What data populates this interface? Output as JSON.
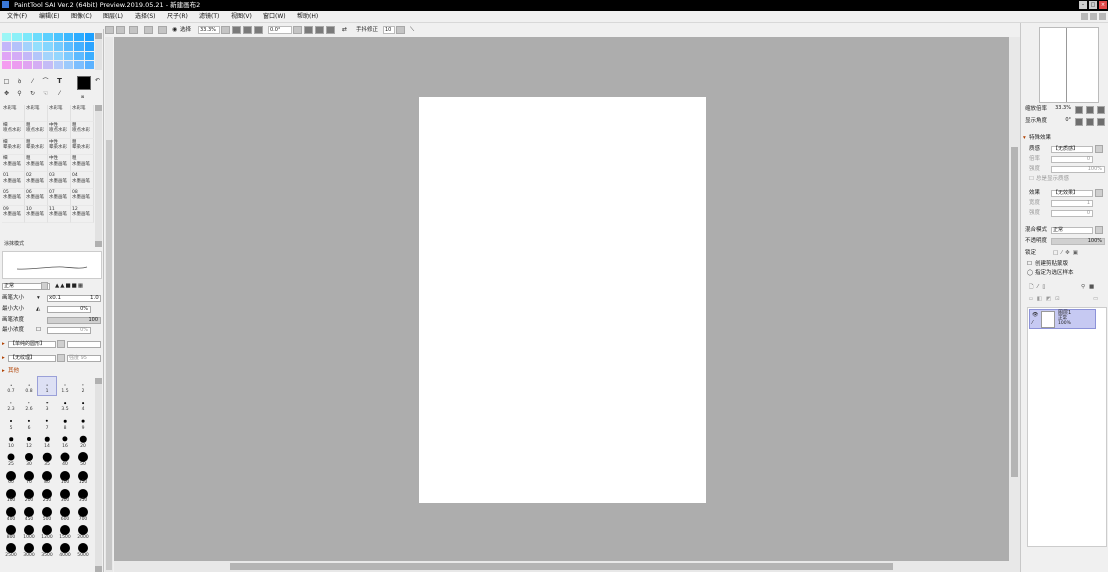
{
  "title_bar": {
    "title": "PaintTool SAI Ver.2 (64bit) Preview.2019.05.21 - 新建画布2"
  },
  "menu": [
    "文件(F)",
    "编辑(E)",
    "图像(C)",
    "图层(L)",
    "选择(S)",
    "尺子(R)",
    "滤镜(T)",
    "视图(V)",
    "窗口(W)",
    "帮助(H)"
  ],
  "toolbar": {
    "selection_label": "选择",
    "zoom": "33.3%",
    "rotation": "0.0°",
    "stabilizer_label": "手抖修正",
    "stabilizer_value": "10"
  },
  "palette_colors": [
    "#9cf6f6",
    "#8cf0f8",
    "#7ce8fa",
    "#6cdcfc",
    "#5cd0fe",
    "#4cc4ff",
    "#3cb8ff",
    "#2cacff",
    "#1ca0ff",
    "#c4b6fa",
    "#b4c2fa",
    "#a4d2fc",
    "#94dffd",
    "#84d6fe",
    "#74cafe",
    "#5cbcff",
    "#44b0ff",
    "#2ca4ff",
    "#e0a4f6",
    "#d4acf6",
    "#c4b8f8",
    "#b4c6fa",
    "#a4d4fc",
    "#94d6fe",
    "#7ccaff",
    "#5cbaff",
    "#3caeff",
    "#f49cf0",
    "#ec9cf0",
    "#e0a4f2",
    "#d4aef4",
    "#c4bcf6",
    "#b4cafa",
    "#9ccafc",
    "#7cbefe",
    "#5cb2ff"
  ],
  "brushes": [
    {
      "label": "",
      "name": "水彩笔"
    },
    {
      "label": "",
      "name": "水彩笔"
    },
    {
      "label": "",
      "name": "水彩笔"
    },
    {
      "label": "",
      "name": "水彩笔"
    },
    {
      "label": "细",
      "name": "喷点水彩"
    },
    {
      "label": "粗",
      "name": "喷点水彩"
    },
    {
      "label": "中性",
      "name": "喷点水彩"
    },
    {
      "label": "粗",
      "name": "喷点水彩"
    },
    {
      "label": "细",
      "name": "晕染水彩"
    },
    {
      "label": "粗",
      "name": "晕染水彩"
    },
    {
      "label": "中性",
      "name": "晕染水彩"
    },
    {
      "label": "粗",
      "name": "晕染水彩"
    },
    {
      "label": "细",
      "name": "水墨画笔"
    },
    {
      "label": "粗",
      "name": "水墨画笔"
    },
    {
      "label": "中性",
      "name": "水墨画笔"
    },
    {
      "label": "粗",
      "name": "水墨画笔"
    },
    {
      "label": "01",
      "name": "水墨画笔"
    },
    {
      "label": "02",
      "name": "水墨画笔"
    },
    {
      "label": "03",
      "name": "水墨画笔"
    },
    {
      "label": "04",
      "name": "水墨画笔"
    },
    {
      "label": "05",
      "name": "水墨画笔"
    },
    {
      "label": "06",
      "name": "水墨画笔"
    },
    {
      "label": "07",
      "name": "水墨画笔"
    },
    {
      "label": "08",
      "name": "水墨画笔"
    },
    {
      "label": "09",
      "name": "水墨画笔"
    },
    {
      "label": "10",
      "name": "水墨画笔"
    },
    {
      "label": "11",
      "name": "水墨画笔"
    },
    {
      "label": "12",
      "name": "水墨画笔"
    }
  ],
  "current_brush": "涂抹模式",
  "brush_settings": {
    "mode": "正常",
    "size_label": "画笔大小",
    "size_multiplier": "x0.1",
    "size_value": "1.0",
    "min_size_label": "最小大小",
    "min_size_value": "0%",
    "density_label": "画笔浓度",
    "density_value": "100",
    "min_density_label": "最小浓度",
    "min_density_value": "0%",
    "shape_label": "【单纯的圆形】",
    "texture_label": "【无纹理】",
    "texture_strength": "强度",
    "texture_value": "95",
    "other_label": "其他"
  },
  "brush_tips": [
    {
      "label": "0.7",
      "d": 0.6
    },
    {
      "label": "0.8",
      "d": 0.7
    },
    {
      "label": "1",
      "d": 0.8
    },
    {
      "label": "1.5",
      "d": 1
    },
    {
      "label": "2",
      "d": 1.2
    },
    {
      "label": "2.3",
      "d": 1.3
    },
    {
      "label": "2.6",
      "d": 1.4
    },
    {
      "label": "3",
      "d": 1.5
    },
    {
      "label": "3.5",
      "d": 1.7
    },
    {
      "label": "4",
      "d": 1.8
    },
    {
      "label": "5",
      "d": 2
    },
    {
      "label": "6",
      "d": 2.2
    },
    {
      "label": "7",
      "d": 2.4
    },
    {
      "label": "8",
      "d": 2.6
    },
    {
      "label": "9",
      "d": 2.8
    },
    {
      "label": "10",
      "d": 3.5
    },
    {
      "label": "12",
      "d": 4
    },
    {
      "label": "14",
      "d": 4.5
    },
    {
      "label": "16",
      "d": 5.2
    },
    {
      "label": "20",
      "d": 6.5
    },
    {
      "label": "25",
      "d": 7
    },
    {
      "label": "30",
      "d": 8
    },
    {
      "label": "35",
      "d": 8.5
    },
    {
      "label": "40",
      "d": 9
    },
    {
      "label": "50",
      "d": 10
    },
    {
      "label": "60",
      "d": 10
    },
    {
      "label": "70",
      "d": 10
    },
    {
      "label": "80",
      "d": 10
    },
    {
      "label": "100",
      "d": 10
    },
    {
      "label": "120",
      "d": 10
    },
    {
      "label": "160",
      "d": 10
    },
    {
      "label": "200",
      "d": 10
    },
    {
      "label": "250",
      "d": 10
    },
    {
      "label": "300",
      "d": 10
    },
    {
      "label": "350",
      "d": 10
    },
    {
      "label": "400",
      "d": 10
    },
    {
      "label": "450",
      "d": 10
    },
    {
      "label": "500",
      "d": 10
    },
    {
      "label": "600",
      "d": 10
    },
    {
      "label": "700",
      "d": 10
    },
    {
      "label": "800",
      "d": 10
    },
    {
      "label": "1000",
      "d": 10
    },
    {
      "label": "1200",
      "d": 10
    },
    {
      "label": "1500",
      "d": 10
    },
    {
      "label": "2000",
      "d": 10
    },
    {
      "label": "2500",
      "d": 10
    },
    {
      "label": "3000",
      "d": 10
    },
    {
      "label": "3500",
      "d": 10
    },
    {
      "label": "4000",
      "d": 10
    },
    {
      "label": "5000",
      "d": 10
    }
  ],
  "selected_tip": 2,
  "navigator": {
    "zoom_label": "缩放倍率",
    "zoom_value": "33.3%",
    "rotate_label": "显示角度",
    "rotate_value": "0°"
  },
  "effects": {
    "section_label": "特殊效果",
    "paper_label": "质感",
    "paper_value": "【无质感】",
    "scale_label": "倍率",
    "scale_value": "0",
    "strength_label": "强度",
    "strength_value": "100%",
    "checkbox_label": "总是显示质感",
    "effect_label": "效果",
    "effect_value": "【无效果】",
    "width_label": "宽度",
    "width_value": "1",
    "str2_label": "强度",
    "str2_value": "0"
  },
  "layer_props": {
    "blend_label": "混合模式",
    "blend_value": "正常",
    "opacity_label": "不透明度",
    "opacity_value": "100%",
    "lock_label": "锁定",
    "clip_label": "创建剪贴蒙版",
    "ref_label": "指定为选区样本"
  },
  "layers": [
    {
      "name": "图层1",
      "mode": "正常",
      "opacity": "100%"
    }
  ]
}
